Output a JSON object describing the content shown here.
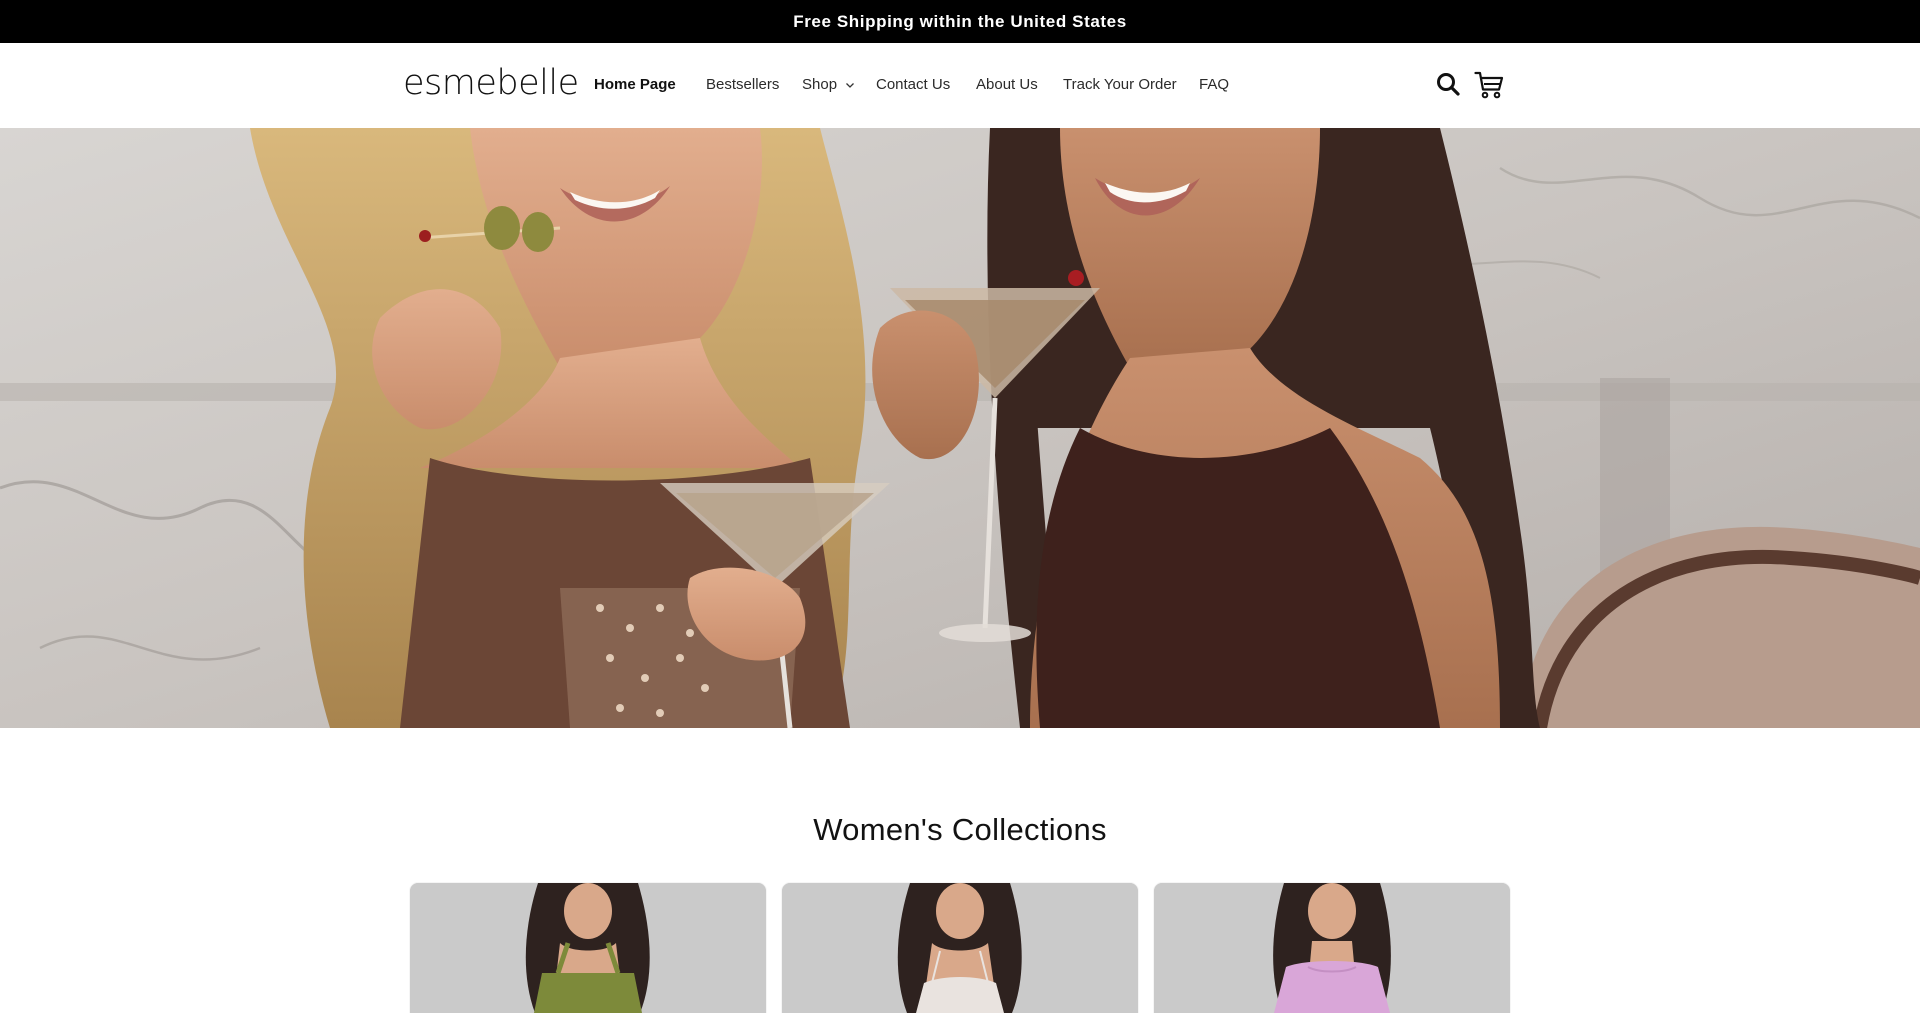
{
  "announcement": {
    "text": "Free Shipping within the United States"
  },
  "header": {
    "logo": "esmebelle",
    "nav": [
      {
        "label": "Home Page",
        "active": true
      },
      {
        "label": "Bestsellers"
      },
      {
        "label": "Shop",
        "has_dropdown": true
      },
      {
        "label": "Contact Us"
      },
      {
        "label": "About Us"
      },
      {
        "label": "Track Your Order"
      },
      {
        "label": "FAQ"
      }
    ],
    "icons": [
      "search-icon",
      "cart-icon"
    ]
  },
  "hero": {
    "image": "hero-image"
  },
  "collections": {
    "title": "Women's Collections",
    "cards": [
      {
        "image": "collection-image",
        "dress_color": "#7d8a3a"
      },
      {
        "image": "collection-image",
        "dress_color": "#e9e3df"
      },
      {
        "image": "collection-image",
        "dress_color": "#d9a6d8"
      }
    ]
  },
  "colors": {
    "announcement_bg": "#000000",
    "text": "#121212",
    "background": "#ffffff"
  }
}
